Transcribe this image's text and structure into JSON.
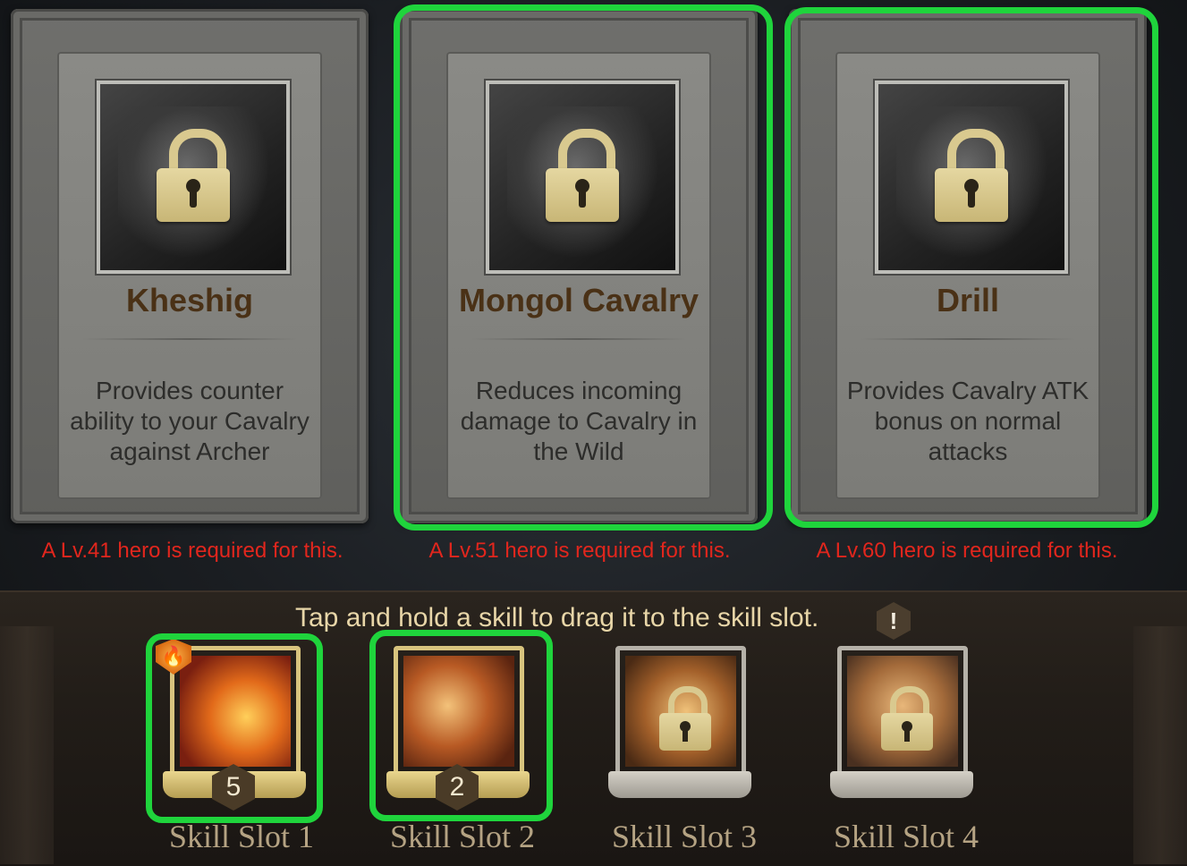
{
  "cards": [
    {
      "title": "Kheshig",
      "description": "Provides counter ability to your Cavalry against Archer",
      "requirement": "A Lv.41 hero is required for this."
    },
    {
      "title": "Mongol Cavalry",
      "description": "Reduces incoming damage to  Cavalry in the Wild",
      "requirement": "A Lv.51 hero is required for this."
    },
    {
      "title": "Drill",
      "description": "Provides Cavalry ATK bonus on normal attacks",
      "requirement": "A Lv.60 hero is required for this."
    }
  ],
  "hint": {
    "text": "Tap and hold a skill to drag it to the skill slot.",
    "icon_glyph": "!"
  },
  "slots": [
    {
      "label": "Skill Slot 1",
      "level": "5",
      "state": "unlocked",
      "icon": "spear-icon"
    },
    {
      "label": "Skill Slot 2",
      "level": "2",
      "state": "unlocked",
      "icon": "horse-hoof-icon"
    },
    {
      "label": "Skill Slot 3",
      "state": "locked",
      "icon": "eagle-icon"
    },
    {
      "label": "Skill Slot 4",
      "state": "locked",
      "icon": "yurt-icon"
    }
  ],
  "badge_glyph": "🔥",
  "colors": {
    "highlight": "#1fd43c",
    "requirement_text": "#e2261d",
    "title_text": "#4a3116"
  }
}
